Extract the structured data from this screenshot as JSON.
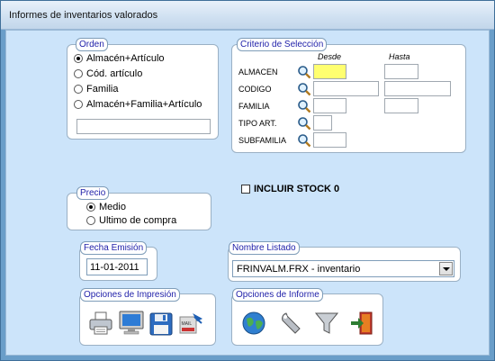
{
  "window": {
    "title": "Informes de inventarios valorados"
  },
  "orden": {
    "caption": "Orden",
    "options": [
      {
        "label": "Almacén+Artículo",
        "selected": true
      },
      {
        "label": "Cód. artículo",
        "selected": false
      },
      {
        "label": "Familia",
        "selected": false
      },
      {
        "label": "Almacén+Familia+Artículo",
        "selected": false
      }
    ],
    "extra_value": ""
  },
  "criterio": {
    "caption": "Criterio de Selección",
    "desde": "Desde",
    "hasta": "Hasta",
    "rows": [
      {
        "label": "ALMACEN",
        "desde": "",
        "hasta": ""
      },
      {
        "label": "CODIGO",
        "desde": "",
        "hasta": ""
      },
      {
        "label": "FAMILIA",
        "desde": "",
        "hasta": ""
      },
      {
        "label": "TIPO ART.",
        "desde": ""
      },
      {
        "label": "SUBFAMILIA",
        "desde": ""
      }
    ]
  },
  "stock": {
    "label": "INCLUIR STOCK 0",
    "checked": false
  },
  "precio": {
    "caption": "Precio",
    "options": [
      {
        "label": "Medio",
        "selected": true
      },
      {
        "label": "Ultimo de compra",
        "selected": false
      }
    ]
  },
  "fecha": {
    "caption": "Fecha Emisión",
    "value": "11-01-2011"
  },
  "listado": {
    "caption": "Nombre Listado",
    "value": "FRINVALM.FRX - inventario"
  },
  "impresion": {
    "caption": "Opciones de Impresión",
    "icons": [
      "printer-icon",
      "monitor-icon",
      "floppy-disk-icon",
      "mail-icon"
    ]
  },
  "informe": {
    "caption": "Opciones de Informe",
    "icons": [
      "globe-icon",
      "wrench-icon",
      "funnel-icon",
      "exit-door-icon"
    ]
  },
  "colors": {
    "highlight_field": "#ffff70",
    "caption_text": "#2222aa",
    "background": "#cce4fa"
  }
}
